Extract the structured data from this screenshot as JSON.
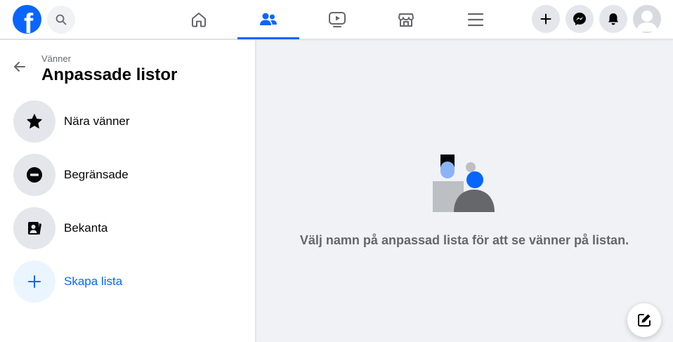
{
  "header": {
    "logo_letter": "f",
    "icons": {
      "search": "search-icon",
      "home": "home-icon",
      "friends": "friends-icon",
      "watch": "video-icon",
      "marketplace": "marketplace-icon",
      "menu": "hamburger-menu-icon",
      "create": "plus-icon",
      "messenger": "messenger-icon",
      "notifications": "bell-icon",
      "account": "avatar"
    },
    "active_tab": "friends"
  },
  "sidebar": {
    "breadcrumb": "Vänner",
    "title": "Anpassade listor",
    "items": [
      {
        "label": "Nära vänner",
        "icon": "star-icon"
      },
      {
        "label": "Begränsade",
        "icon": "restricted-icon"
      },
      {
        "label": "Bekanta",
        "icon": "acquaintance-icon"
      },
      {
        "label": "Skapa lista",
        "icon": "plus-icon"
      }
    ]
  },
  "main": {
    "empty_message": "Välj namn på anpassad lista för att se vänner på listan."
  },
  "colors": {
    "accent": "#0866ff",
    "background": "#f0f2f5",
    "surface": "#ffffff",
    "icon_bg": "#e4e6eb",
    "secondary_text": "#65676b"
  }
}
